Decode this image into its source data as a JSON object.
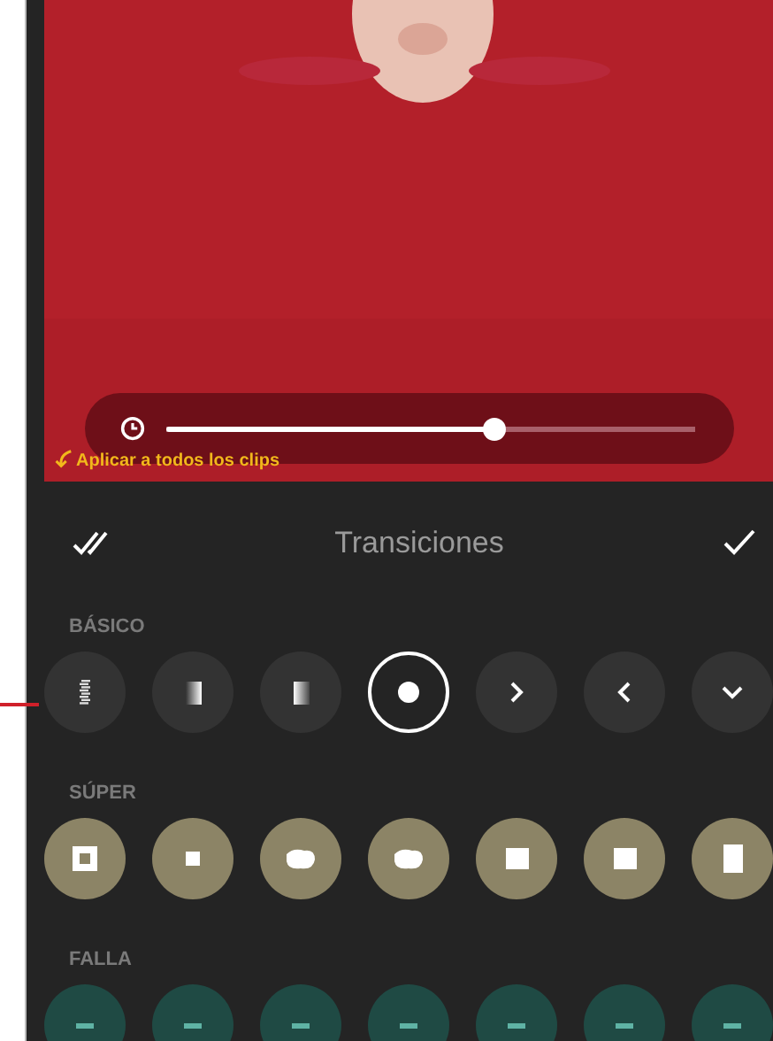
{
  "preview": {
    "kind": "picture",
    "slider": {
      "level": 0.62
    }
  },
  "annotation": {
    "text": "Aplicar a todos los clips"
  },
  "header": {
    "title": "Transiciones"
  },
  "sections": [
    {
      "label": "BÁSICO",
      "items": [
        {
          "kind": "dither",
          "selected": false
        },
        {
          "kind": "fade-left",
          "selected": false
        },
        {
          "kind": "fade-right",
          "selected": false
        },
        {
          "kind": "dot",
          "selected": true
        },
        {
          "kind": "chevron-right",
          "selected": false
        },
        {
          "kind": "chevron-left",
          "selected": false
        },
        {
          "kind": "chevron-down",
          "selected": false
        }
      ]
    },
    {
      "label": "SÚPER",
      "items": [
        {
          "kind": "square-frame",
          "selected": false
        },
        {
          "kind": "square-small",
          "selected": false
        },
        {
          "kind": "blob",
          "selected": false
        },
        {
          "kind": "blob",
          "selected": false
        },
        {
          "kind": "square-fade",
          "selected": false
        },
        {
          "kind": "square-fade",
          "selected": false
        },
        {
          "kind": "square-tall",
          "selected": false
        }
      ]
    },
    {
      "label": "FALLA",
      "items": [
        {
          "kind": "glitch",
          "selected": false
        },
        {
          "kind": "glitch",
          "selected": false
        },
        {
          "kind": "glitch",
          "selected": false
        },
        {
          "kind": "glitch",
          "selected": false
        },
        {
          "kind": "glitch",
          "selected": false
        },
        {
          "kind": "glitch",
          "selected": false
        },
        {
          "kind": "glitch",
          "selected": false
        }
      ]
    }
  ]
}
